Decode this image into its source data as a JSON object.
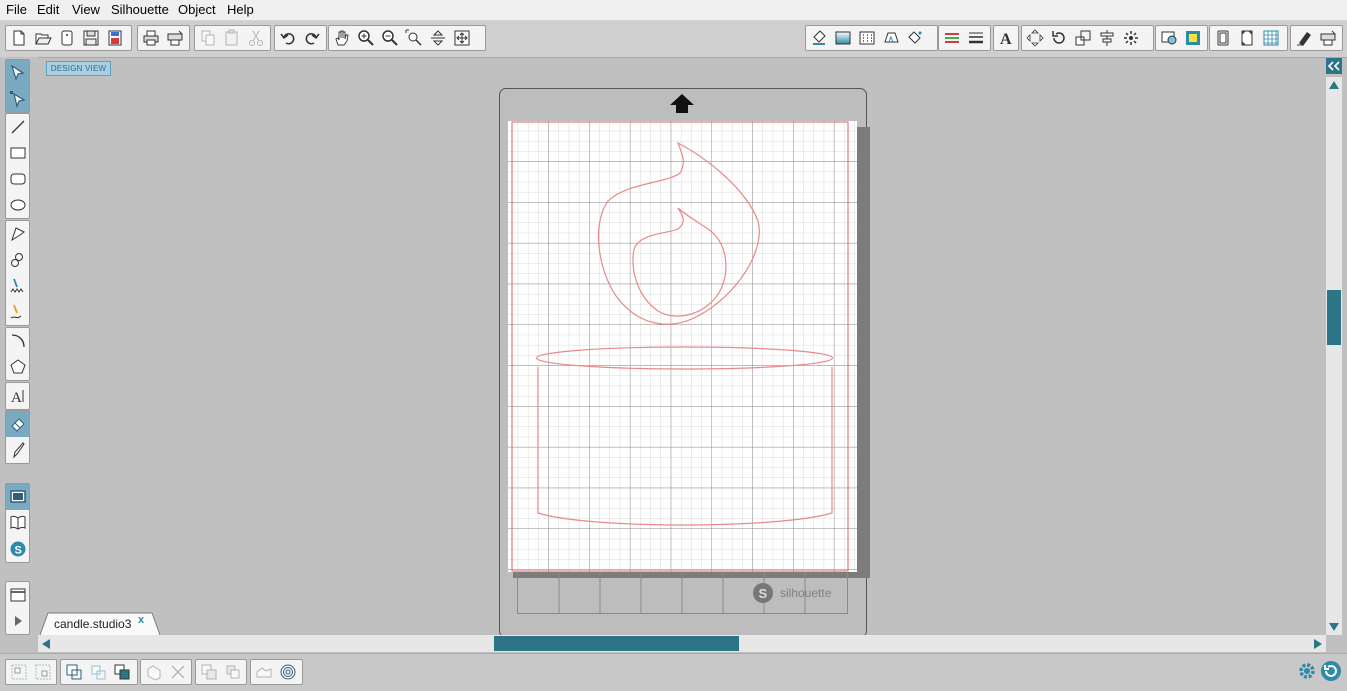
{
  "menu": [
    "File",
    "Edit",
    "View",
    "Silhouette",
    "Object",
    "Help"
  ],
  "view_tab": "DESIGN VIEW",
  "document_tab": {
    "name": "candle.studio3",
    "close": "x"
  },
  "mat_brand": "silhouette",
  "colors": {
    "accent": "#2d8aa8",
    "cut_line": "#e88a8a",
    "page_border": "#e06060",
    "scroll_thumb": "#2c7587"
  },
  "toolbar_left_groups": [
    [
      "new-icon",
      "open-icon",
      "open-library-icon",
      "save-icon",
      "save-to-library-icon"
    ],
    [
      "print-icon",
      "send-to-silhouette-icon"
    ],
    [
      "copy-icon",
      "paste-icon",
      "cut-icon"
    ],
    [
      "undo-icon",
      "redo-icon"
    ],
    [
      "pan-hand-icon",
      "zoom-in-icon",
      "zoom-out-icon",
      "zoom-select-icon",
      "zoom-drag-icon",
      "fit-to-page-icon"
    ]
  ],
  "toolbar_right_groups": [
    [
      "fill-color-icon",
      "gradient-fill-icon",
      "pattern-fill-icon",
      "line-color-icon",
      "line-style-icon"
    ],
    [
      "line-color-bars-icon",
      "line-width-icon"
    ],
    [
      "text-style-icon"
    ],
    [
      "transform-icon",
      "rotate-icon",
      "scale-icon",
      "align-icon",
      "replicate-icon"
    ],
    [
      "trace-icon",
      "offset-icon"
    ],
    [
      "page-setup-icon",
      "registration-marks-icon",
      "grid-settings-icon"
    ],
    [
      "eraser-tool-icon",
      "cut-settings-icon"
    ]
  ],
  "left_tool_groups": [
    [
      "select-tool-icon",
      "edit-points-icon"
    ],
    [
      "line-tool-icon",
      "rectangle-tool-icon",
      "rounded-rectangle-tool-icon",
      "ellipse-tool-icon"
    ],
    [
      "polygon-tool-icon",
      "curve-tool-icon",
      "freehand-tool-icon",
      "smooth-freehand-tool-icon"
    ],
    [
      "arc-tool-icon",
      "regular-polygon-tool-icon"
    ],
    [
      "text-tool-icon"
    ],
    [
      "eraser-icon",
      "knife-tool-icon"
    ],
    [
      "design-view-icon",
      "library-view-icon",
      "online-store-icon"
    ],
    [
      "show-panels-icon",
      "play-icon"
    ]
  ],
  "bottom_groups": [
    [
      "group-icon",
      "ungroup-icon"
    ],
    [
      "make-compound-path-icon",
      "release-compound-path-icon",
      "bring-to-front-icon"
    ],
    [
      "weld-icon",
      "delete-icon"
    ],
    [
      "duplicate-icon",
      "mirror-icon"
    ],
    [
      "shape-icon",
      "target-icon"
    ]
  ],
  "bottom_right_icons": [
    "settings-gear-icon",
    "rotate-view-icon"
  ]
}
